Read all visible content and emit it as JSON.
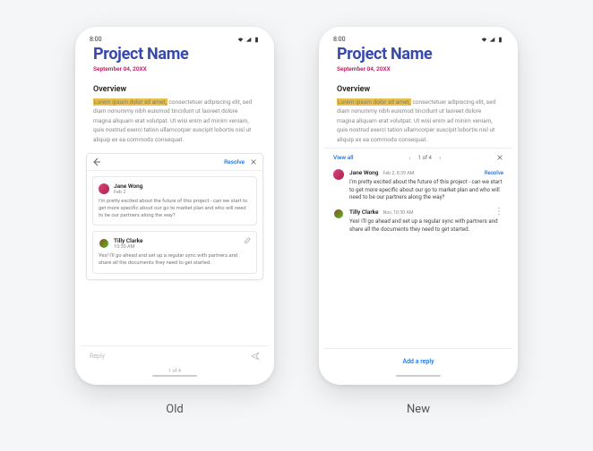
{
  "captions": {
    "old": "Old",
    "new": "New"
  },
  "statusbar": {
    "time": "8:00"
  },
  "doc": {
    "title": "Project Name",
    "date": "September 04, 20XX",
    "section": "Overview",
    "highlight": "Lorem ipsum dolor sit amet,",
    "body_rest": " consectetuer adipiscing elit, sed diam nonummy nibh euismod tincidunt ut laoreet dolore magna aliquam erat volutpat. Ut wisi enim ad minim veniam, quis nostrud exerci tation ullamcorper suscipit lobortis nisl ut aliquip ex ea commodo consequat."
  },
  "old": {
    "resolve": "Resolve",
    "comments": [
      {
        "author": "Jane Wong",
        "time": "Feb 2",
        "body": "I'm pretty excited about the future of this project - can we start to get more specific about our go to market plan and who will need to be our partners along the way?"
      },
      {
        "author": "Tilly Clarke",
        "time": "10:30 AM",
        "body": "Yes! I'll go ahead and set up a regular sync with partners and share all the documents they need to get started."
      }
    ],
    "reply_placeholder": "Reply",
    "pager": "1 of 4"
  },
  "new": {
    "view_all": "View all",
    "pager": {
      "label": "1 of 4"
    },
    "resolve": "Resolve",
    "comments": [
      {
        "author": "Jane Wong",
        "time": "Feb 2, 8:39 AM",
        "body": "I'm pretty excited about the future of this project - can we start to get more specific about our go to market plan and who will need to be our partners along the way?"
      },
      {
        "author": "Tilly Clarke",
        "time": "Nov, 10:30 AM",
        "body": "Yes! I'll go ahead and set up a regular sync with partners and share all the documents they need to get started."
      }
    ],
    "add_reply": "Add a reply"
  }
}
